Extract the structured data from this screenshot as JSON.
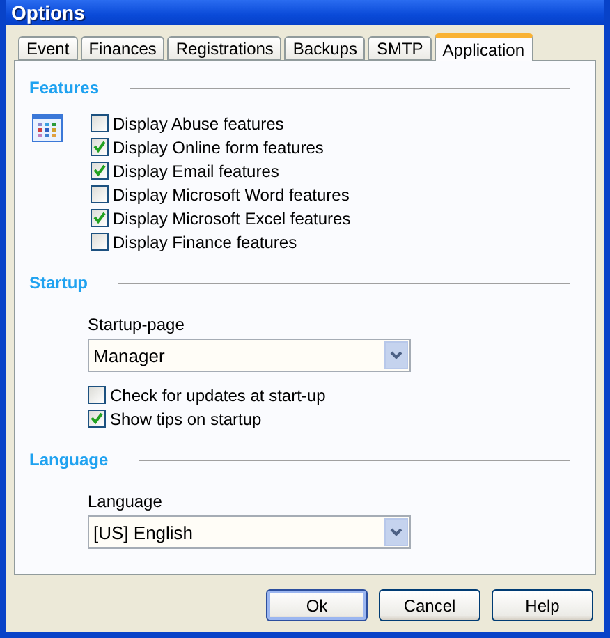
{
  "window": {
    "title": "Options"
  },
  "tabs": [
    {
      "label": "Event",
      "selected": false
    },
    {
      "label": "Finances",
      "selected": false
    },
    {
      "label": "Registrations",
      "selected": false
    },
    {
      "label": "Backups",
      "selected": false
    },
    {
      "label": "SMTP",
      "selected": false
    },
    {
      "label": "Application",
      "selected": true
    }
  ],
  "sections": [
    {
      "title": "Features",
      "kind": "iconed",
      "fields": [
        {
          "kind": "checkbox",
          "label": "Display Abuse features",
          "checked": false
        },
        {
          "kind": "checkbox",
          "label": "Display Online form features",
          "checked": true
        },
        {
          "kind": "checkbox",
          "label": "Display Email features",
          "checked": true
        },
        {
          "kind": "checkbox",
          "label": "Display Microsoft Word features",
          "checked": false
        },
        {
          "kind": "checkbox",
          "label": "Display Microsoft Excel features",
          "checked": true
        },
        {
          "kind": "checkbox",
          "label": "Display Finance features",
          "checked": false
        }
      ]
    },
    {
      "title": "Startup",
      "kind": "plain",
      "fields": [
        {
          "kind": "dropdown",
          "label": "Startup-page",
          "value": "Manager"
        },
        {
          "kind": "checkbox",
          "label": "Check for updates at start-up",
          "checked": false
        },
        {
          "kind": "checkbox",
          "label": "Show tips on startup",
          "checked": true
        }
      ]
    },
    {
      "title": "Language",
      "kind": "plain",
      "fields": [
        {
          "kind": "dropdown",
          "label": "Language",
          "value": "[US] English"
        }
      ]
    }
  ],
  "buttons": [
    {
      "label": "Ok",
      "default": true
    },
    {
      "label": "Cancel",
      "default": false
    },
    {
      "label": "Help",
      "default": false
    }
  ]
}
